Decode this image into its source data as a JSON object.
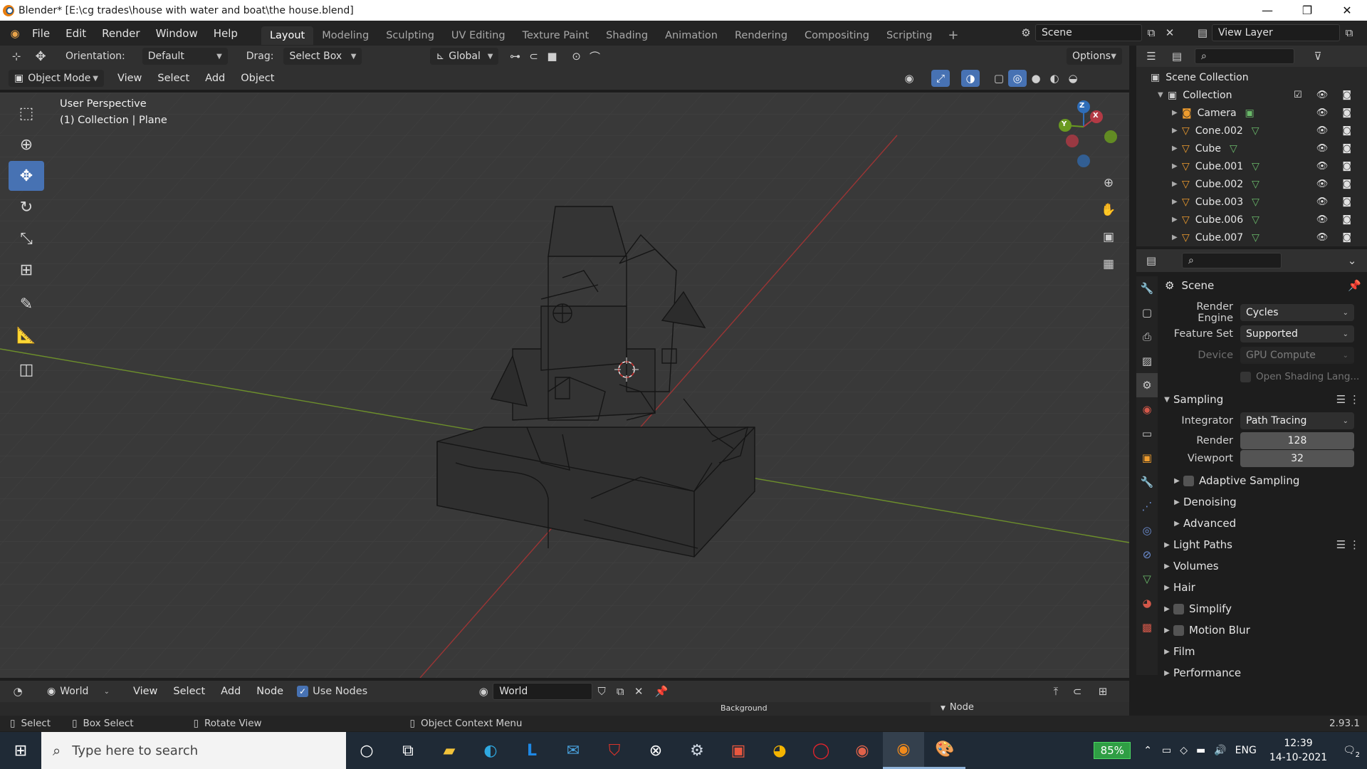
{
  "window": {
    "title": "Blender* [E:\\cg trades\\house with water and boat\\the house.blend]",
    "controls": [
      "—",
      "❐",
      "✕"
    ]
  },
  "menubar": {
    "items": [
      "File",
      "Edit",
      "Render",
      "Window",
      "Help"
    ],
    "workspaces": [
      "Layout",
      "Modeling",
      "Sculpting",
      "UV Editing",
      "Texture Paint",
      "Shading",
      "Animation",
      "Rendering",
      "Compositing",
      "Scripting"
    ],
    "active_workspace": "Layout",
    "scene": "Scene",
    "view_layer": "View Layer"
  },
  "tool_header": {
    "orientation_label": "Orientation:",
    "orientation_value": "Default",
    "drag_label": "Drag:",
    "drag_value": "Select Box",
    "transform_orientation": "Global",
    "options": "Options"
  },
  "viewport_header": {
    "mode": "Object Mode",
    "menus": [
      "View",
      "Select",
      "Add",
      "Object"
    ]
  },
  "viewport": {
    "perspective": "User Perspective",
    "context": "(1) Collection | Plane",
    "gizmo_axes": [
      "Z",
      "Y",
      "X"
    ]
  },
  "outliner": {
    "root": "Scene Collection",
    "collection": "Collection",
    "objects": [
      "Camera",
      "Cone.002",
      "Cube",
      "Cube.001",
      "Cube.002",
      "Cube.003",
      "Cube.006",
      "Cube.007"
    ]
  },
  "properties": {
    "context": "Scene",
    "render_engine_label": "Render Engine",
    "render_engine": "Cycles",
    "feature_set_label": "Feature Set",
    "feature_set": "Supported",
    "device_label": "Device",
    "device": "GPU Compute",
    "osl": "Open Shading Lang...",
    "sampling": "Sampling",
    "integrator_label": "Integrator",
    "integrator": "Path Tracing",
    "render_label": "Render",
    "render_samples": "128",
    "viewport_label": "Viewport",
    "viewport_samples": "32",
    "adaptive_sampling": "Adaptive Sampling",
    "denoising": "Denoising",
    "advanced": "Advanced",
    "panels": [
      "Light Paths",
      "Volumes",
      "Hair",
      "Simplify",
      "Motion Blur",
      "Film",
      "Performance"
    ]
  },
  "node_header": {
    "world_type": "World",
    "menus": [
      "View",
      "Select",
      "Add",
      "Node"
    ],
    "use_nodes": "Use Nodes",
    "world_name": "World",
    "background_node": "Background",
    "sidebar_tab": "Node"
  },
  "statusbar": {
    "select": "Select",
    "box_select": "Box Select",
    "rotate_view": "Rotate View",
    "context_menu": "Object Context Menu",
    "version": "2.93.1"
  },
  "taskbar": {
    "search_placeholder": "Type here to search",
    "battery": "85%",
    "language": "ENG",
    "time": "12:39",
    "date": "14-10-2021",
    "notifications": "2"
  }
}
